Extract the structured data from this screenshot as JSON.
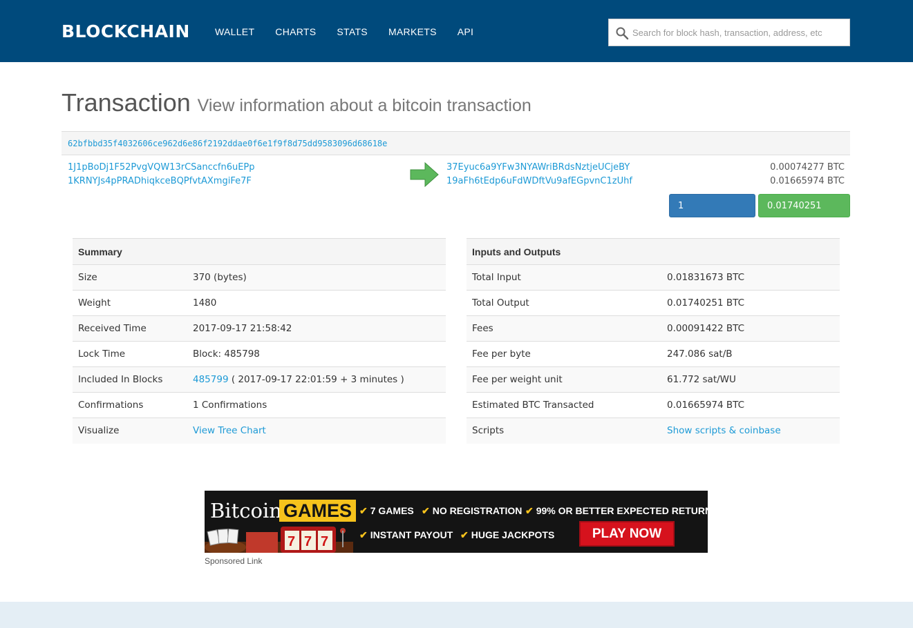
{
  "header": {
    "brand": "BLOCKCHAIN",
    "nav": [
      "WALLET",
      "CHARTS",
      "STATS",
      "MARKETS",
      "API"
    ],
    "search_placeholder": "Search for block hash, transaction, address, etc"
  },
  "page": {
    "title": "Transaction",
    "subtitle": "View information about a bitcoin transaction"
  },
  "tx": {
    "hash": "62bfbbd35f4032606ce962d6e86f2192ddae0f6e1f9f8d75dd9583096d68618e",
    "inputs": [
      "1J1pBoDj1F52PvgVQW13rCSanccfn6uEPp",
      "1KRNYJs4pPRADhiqkceBQPfvtAXmgiFe7F"
    ],
    "outputs": [
      {
        "address": "37Eyuc6a9YFw3NYAWriBRdsNztjeUCjeBY",
        "amount": "0.00074277 BTC"
      },
      {
        "address": "19aFh6tEdp6uFdWDftVu9afEGpvnC1zUhf",
        "amount": "0.01665974 BTC"
      }
    ],
    "confirmations_button": "1 Confirmations",
    "total_button": "0.01740251 BTC"
  },
  "summary": {
    "heading": "Summary",
    "rows": {
      "size": {
        "k": "Size",
        "v": "370 (bytes)"
      },
      "weight": {
        "k": "Weight",
        "v": "1480"
      },
      "received": {
        "k": "Received Time",
        "v": "2017-09-17 21:58:42"
      },
      "lock": {
        "k": "Lock Time",
        "v": "Block: 485798"
      },
      "included": {
        "k": "Included In Blocks",
        "block": "485799",
        "v": " ( 2017-09-17 22:01:59 + 3 minutes )"
      },
      "confirmations": {
        "k": "Confirmations",
        "v": "1 Confirmations"
      },
      "visualize": {
        "k": "Visualize",
        "v": "View Tree Chart"
      }
    }
  },
  "io": {
    "heading": "Inputs and Outputs",
    "rows": {
      "total_input": {
        "k": "Total Input",
        "v": "0.01831673 BTC"
      },
      "total_output": {
        "k": "Total Output",
        "v": "0.01740251 BTC"
      },
      "fees": {
        "k": "Fees",
        "v": "0.00091422 BTC"
      },
      "fee_byte": {
        "k": "Fee per byte",
        "v": "247.086 sat/B"
      },
      "fee_wu": {
        "k": "Fee per weight unit",
        "v": "61.772 sat/WU"
      },
      "estimated": {
        "k": "Estimated BTC Transacted",
        "v": "0.01665974 BTC"
      },
      "scripts": {
        "k": "Scripts",
        "v": "Show scripts & coinbase"
      }
    }
  },
  "ad": {
    "brand": "Bitcoin",
    "games": "GAMES",
    "features": [
      "7 GAMES",
      "NO REGISTRATION",
      "99% OR BETTER EXPECTED RETURN",
      "INSTANT PAYOUT",
      "HUGE JACKPOTS"
    ],
    "cta": "PLAY NOW",
    "check": "✔",
    "sponsored": "Sponsored Link"
  }
}
